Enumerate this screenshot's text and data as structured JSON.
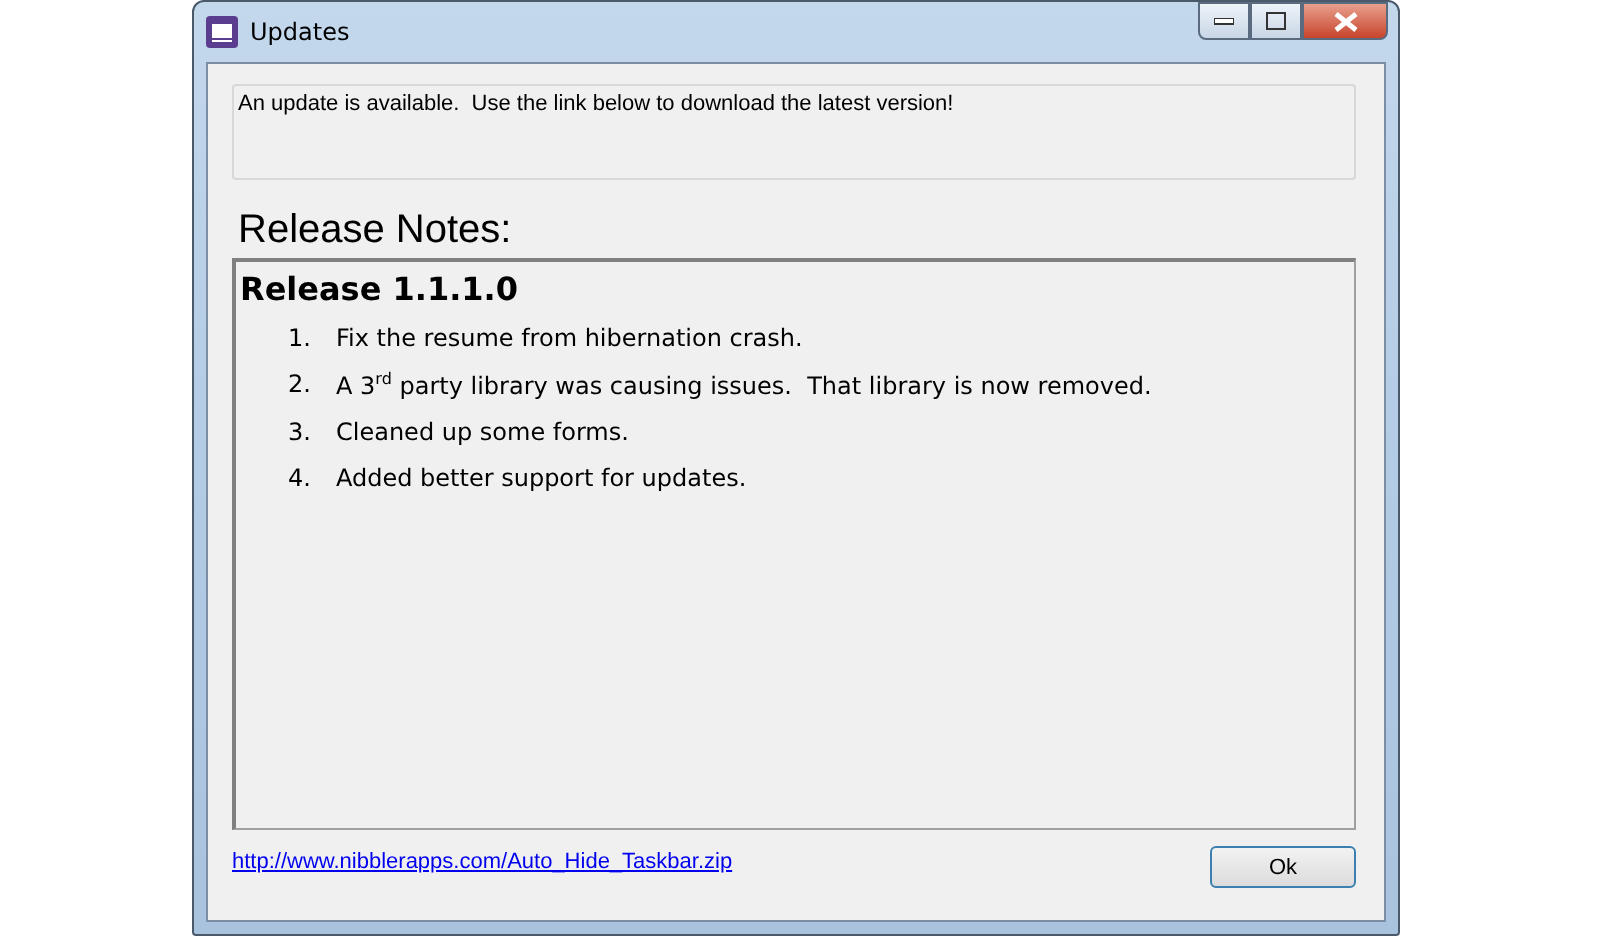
{
  "window": {
    "title": "Updates"
  },
  "message": "An update is available.  Use the link below to download the latest version!",
  "release_notes": {
    "heading": "Release Notes:",
    "release_title": "Release 1.1.1.0",
    "items": [
      {
        "number": "1.",
        "text": "Fix the resume from hibernation crash."
      },
      {
        "number": "2.",
        "text": "A 3$^{rd}$ party library was causing issues.  That library is now removed."
      },
      {
        "number": "3.",
        "text": "Cleaned up some forms."
      },
      {
        "number": "4.",
        "text": "Added better support for updates."
      }
    ]
  },
  "link": "http://www.nibblerapps.com/Auto_Hide_Taskbar.zip",
  "buttons": [
    "Ok"
  ]
}
